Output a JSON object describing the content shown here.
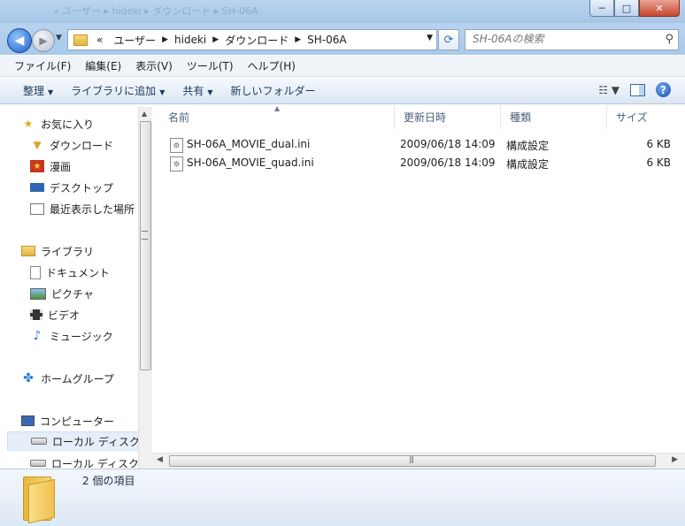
{
  "window": {
    "blurred_title": "« ユーザー ▸ hideki ▸ ダウンロード ▸ SH-06A",
    "min_label": "─",
    "max_label": "□",
    "close_label": "✕"
  },
  "address": {
    "overflow": "«",
    "crumbs": [
      "ユーザー",
      "hideki",
      "ダウンロード",
      "SH-06A"
    ]
  },
  "search": {
    "placeholder": "SH-06Aの検索"
  },
  "menubar": [
    "ファイル(F)",
    "編集(E)",
    "表示(V)",
    "ツール(T)",
    "ヘルプ(H)"
  ],
  "toolbar": {
    "organize": "整理",
    "add_to_library": "ライブラリに追加",
    "share": "共有",
    "new_folder": "新しいフォルダー"
  },
  "nav": {
    "favorites": {
      "title": "お気に入り",
      "items": [
        "ダウンロード",
        "漫画",
        "デスクトップ",
        "最近表示した場所"
      ]
    },
    "libraries": {
      "title": "ライブラリ",
      "items": [
        "ドキュメント",
        "ピクチャ",
        "ビデオ",
        "ミュージック"
      ]
    },
    "homegroup": "ホームグループ",
    "computer": {
      "title": "コンピューター",
      "items": [
        "ローカル ディスク",
        "ローカル ディスク"
      ]
    }
  },
  "columns": {
    "name": "名前",
    "modified": "更新日時",
    "type": "種類",
    "size": "サイズ"
  },
  "files": [
    {
      "name": "SH-06A_MOVIE_dual.ini",
      "modified": "2009/06/18 14:09",
      "type": "構成設定",
      "size": "6 KB"
    },
    {
      "name": "SH-06A_MOVIE_quad.ini",
      "modified": "2009/06/18 14:09",
      "type": "構成設定",
      "size": "6 KB"
    }
  ],
  "status": {
    "item_count": "2 個の項目"
  },
  "icons": [
    "back-icon",
    "forward-icon",
    "folder-icon",
    "refresh-icon",
    "search-icon",
    "star-icon",
    "help-icon",
    "views-icon",
    "preview-pane-icon",
    "ini-file-icon"
  ]
}
